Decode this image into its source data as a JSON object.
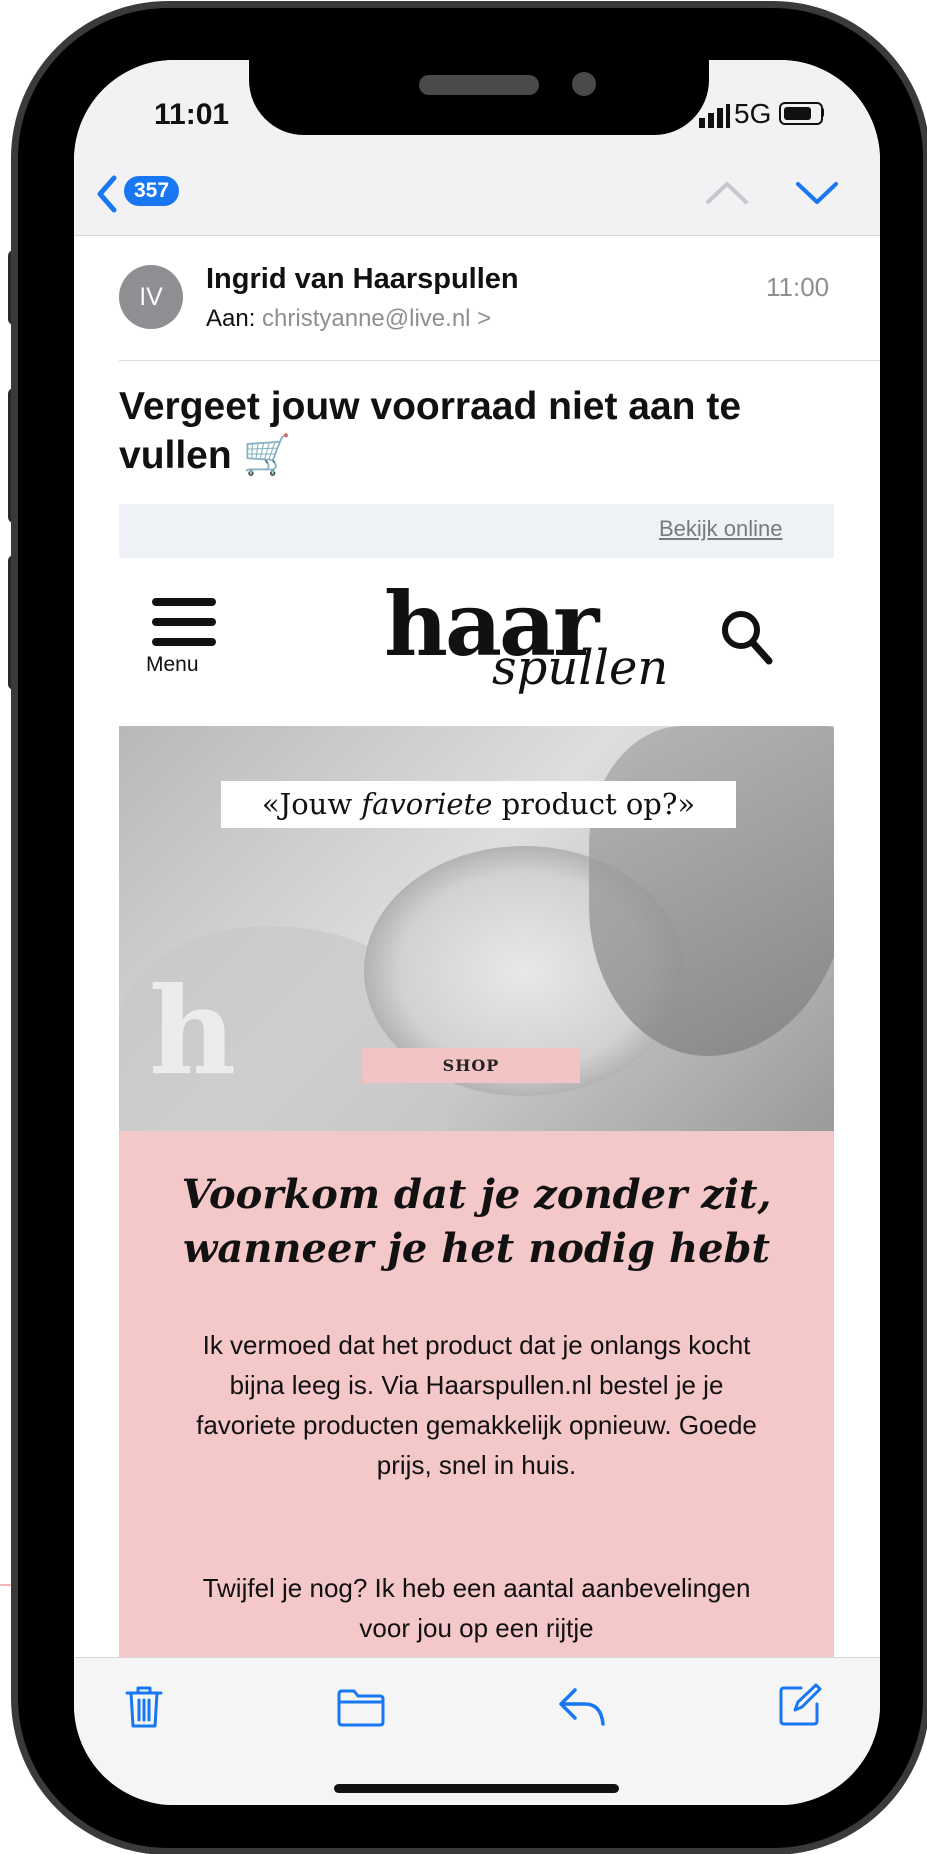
{
  "status_bar": {
    "time": "11:01",
    "network": "5G"
  },
  "nav": {
    "unread_count": "357"
  },
  "email": {
    "avatar_initials": "IV",
    "sender": "Ingrid van Haarspullen",
    "recipient_label": "Aan:",
    "recipient_address": "christyanne@live.nl >",
    "received_time": "11:00",
    "subject": "Vergeet jouw voorraad niet aan te vullen 🛒"
  },
  "newsletter": {
    "view_online": "Bekijk online",
    "menu_label": "Menu",
    "logo_main": "haar",
    "logo_sub": "spullen",
    "hero_tag_before": "«Jouw ",
    "hero_tag_italic": "favoriete",
    "hero_tag_after": " product op?»",
    "hero_watermark": "h",
    "shop_button": "SHOP",
    "headline": "Voorkom dat je zonder zit, wanneer je het nodig hebt",
    "body_paragraph_1": "Ik vermoed dat het product dat je onlangs kocht bijna leeg is. Via Haarspullen.nl bestel je je favoriete producten gemakkelijk opnieuw. Goede prijs, snel in huis.",
    "body_paragraph_2": "Twijfel je nog? Ik heb een aantal aanbevelingen voor jou op een rijtje"
  },
  "colors": {
    "accent": "#1877f2",
    "pink_block": "#f4c7c8",
    "shop_button": "#f2c4c4"
  },
  "icons": {
    "back": "chevron-left-icon",
    "prev": "chevron-up-icon",
    "next": "chevron-down-icon",
    "menu": "hamburger-icon",
    "search": "search-icon",
    "trash": "trash-icon",
    "folder": "folder-icon",
    "reply": "reply-icon",
    "compose": "compose-icon"
  }
}
